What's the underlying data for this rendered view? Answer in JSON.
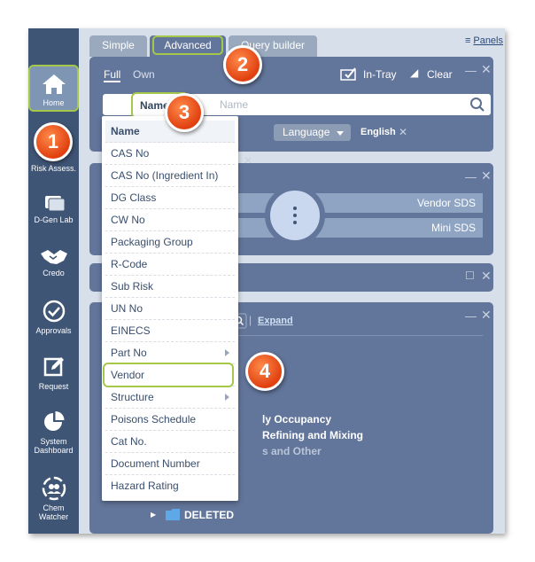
{
  "tabs": {
    "simple": "Simple",
    "advanced": "Advanced",
    "query": "Query builder"
  },
  "panels_label": "Panels",
  "sidebar": {
    "items": [
      {
        "label": "Home"
      },
      {
        "label": "Risk Assess."
      },
      {
        "label": "D-Gen Lab"
      },
      {
        "label": "Credo"
      },
      {
        "label": "Approvals"
      },
      {
        "label": "Request"
      },
      {
        "label": "System Dashboard"
      },
      {
        "label": "Chem Watcher"
      }
    ]
  },
  "search_panel": {
    "full": "Full",
    "own": "Own",
    "in_tray": "In-Tray",
    "clear": "Clear",
    "field_selected": "Name",
    "placeholder": "Name",
    "language_label": "Language",
    "language_value": "English"
  },
  "bars": {
    "vendor_sds": "Vendor SDS",
    "mini_sds": "Mini SDS"
  },
  "lower_panel": {
    "expand": "Expand"
  },
  "tree_text": [
    "ly Occupancy",
    "Refining and Mixing",
    "s and Other",
    "DELETED"
  ],
  "dropdown": {
    "options": [
      "Name",
      "CAS No",
      "CAS No (Ingredient In)",
      "DG Class",
      "CW No",
      "Packaging Group",
      "R-Code",
      "Sub Risk",
      "UN No",
      "EINECS",
      "Part No",
      "Vendor",
      "Structure",
      "Poisons Schedule",
      "Cat No.",
      "Document Number",
      "Hazard Rating"
    ]
  },
  "callouts": [
    "1",
    "2",
    "3",
    "4"
  ],
  "colors": {
    "accent_green": "#a6c84a",
    "callout_orange": "#e0400f",
    "panel_blue": "#62759a"
  }
}
